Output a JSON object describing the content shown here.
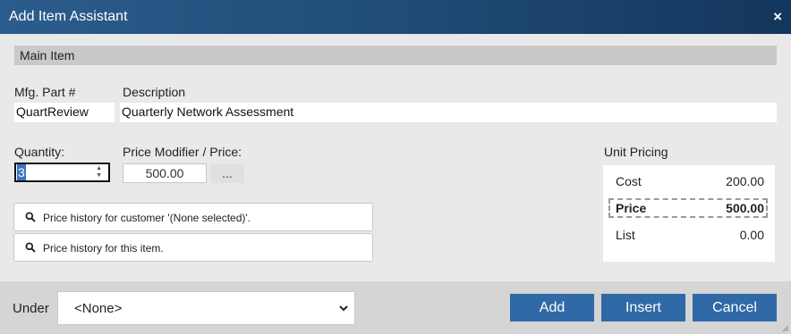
{
  "window": {
    "title": "Add Item Assistant",
    "close_icon": "×"
  },
  "section": {
    "title": "Main Item"
  },
  "item": {
    "part_label": "Mfg. Part #",
    "part_value": "QuartReview",
    "desc_label": "Description",
    "desc_value": "Quarterly Network Assessment"
  },
  "quantity": {
    "label": "Quantity:",
    "value": "3"
  },
  "price": {
    "label": "Price Modifier / Price:",
    "value": "500.00",
    "more": "..."
  },
  "history": {
    "customer": "Price history for customer '(None selected)'.",
    "item": "Price history for this item."
  },
  "unit_pricing": {
    "title": "Unit Pricing",
    "rows": [
      {
        "label": "Cost",
        "value": "200.00"
      },
      {
        "label": "Price",
        "value": "500.00"
      },
      {
        "label": "List",
        "value": "0.00"
      }
    ]
  },
  "footer": {
    "under_label": "Under",
    "under_value": "<None>",
    "add": "Add",
    "insert": "Insert",
    "cancel": "Cancel"
  },
  "colors": {
    "titlebar": "#1f4a75",
    "button": "#2f6aa6",
    "selection": "#3a75c4"
  },
  "icons": [
    "close-icon",
    "search-icon",
    "chevron-down-icon",
    "resize-grip-icon",
    "spinner-arrows-icon"
  ]
}
